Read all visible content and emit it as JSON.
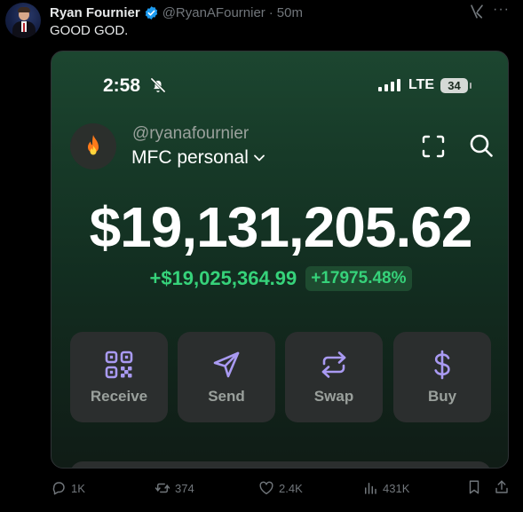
{
  "tweet": {
    "author_name": "Ryan Fournier",
    "handle": "@RyanAFournier",
    "separator": "·",
    "time": "50m",
    "text": "GOOD GOD.",
    "more_label": "···"
  },
  "phone": {
    "status_bar": {
      "time": "2:58",
      "network": "LTE",
      "battery": "34"
    },
    "account": {
      "username": "@ryanafournier",
      "name": "MFC personal",
      "emoji": "🔥"
    },
    "balance": "$19,131,205.62",
    "change_amount": "+$19,025,364.99",
    "change_percent": "+17975.48%",
    "actions": [
      {
        "label": "Receive",
        "icon": "qr-code-icon"
      },
      {
        "label": "Send",
        "icon": "send-icon"
      },
      {
        "label": "Swap",
        "icon": "swap-icon"
      },
      {
        "label": "Buy",
        "icon": "dollar-icon"
      }
    ]
  },
  "metrics": {
    "replies": "1K",
    "reposts": "374",
    "likes": "2.4K",
    "views": "431K"
  },
  "colors": {
    "accent_green": "#36d27a",
    "action_icon": "#a99af2",
    "verified_blue": "#1d9bf0"
  }
}
